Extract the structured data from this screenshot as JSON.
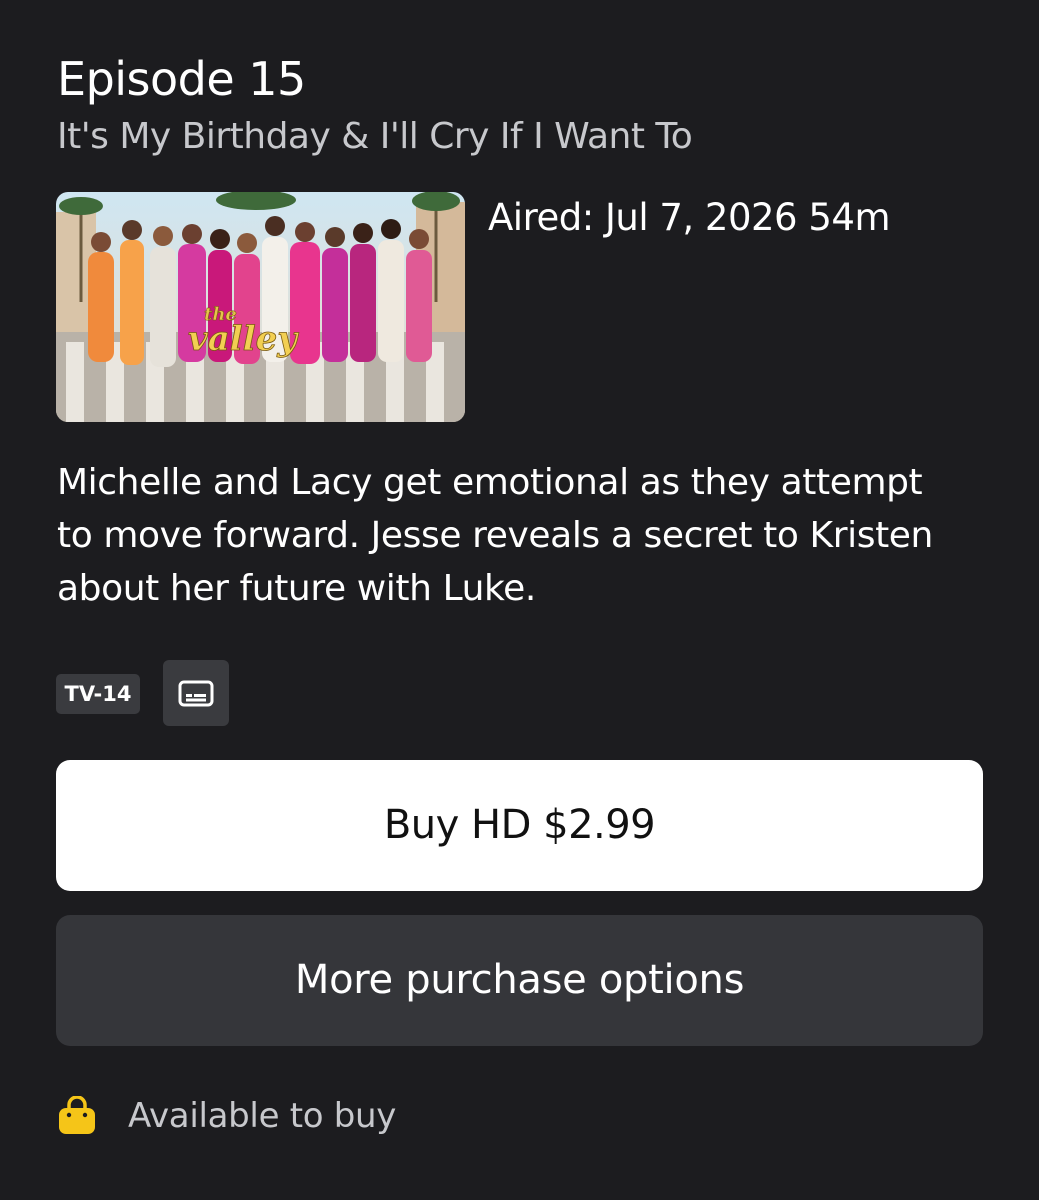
{
  "episode": {
    "number_label": "Episode 15",
    "title": "It's My Birthday & I'll Cry If I Want To",
    "aired": "Aired: Jul 7, 2026 54m",
    "description": "Michelle and Lacy get emotional as they attempt to move forward. Jesse reveals a secret to Kristen about her future with Luke.",
    "thumbnail": {
      "logo_small": "the",
      "logo_large": "valley"
    }
  },
  "badges": {
    "rating": "TV-14",
    "captions_icon": "closed-captions-icon"
  },
  "actions": {
    "buy_label": "Buy HD $2.99",
    "more_label": "More purchase options"
  },
  "availability": {
    "icon": "shopping-bag-icon",
    "label": "Available to buy",
    "icon_color": "#f5c518"
  },
  "colors": {
    "background": "#1c1c1f",
    "secondary_text": "#c7c8cc",
    "badge_bg": "#3a3b3f",
    "secondary_button": "#35363a",
    "primary_button": "#ffffff"
  }
}
